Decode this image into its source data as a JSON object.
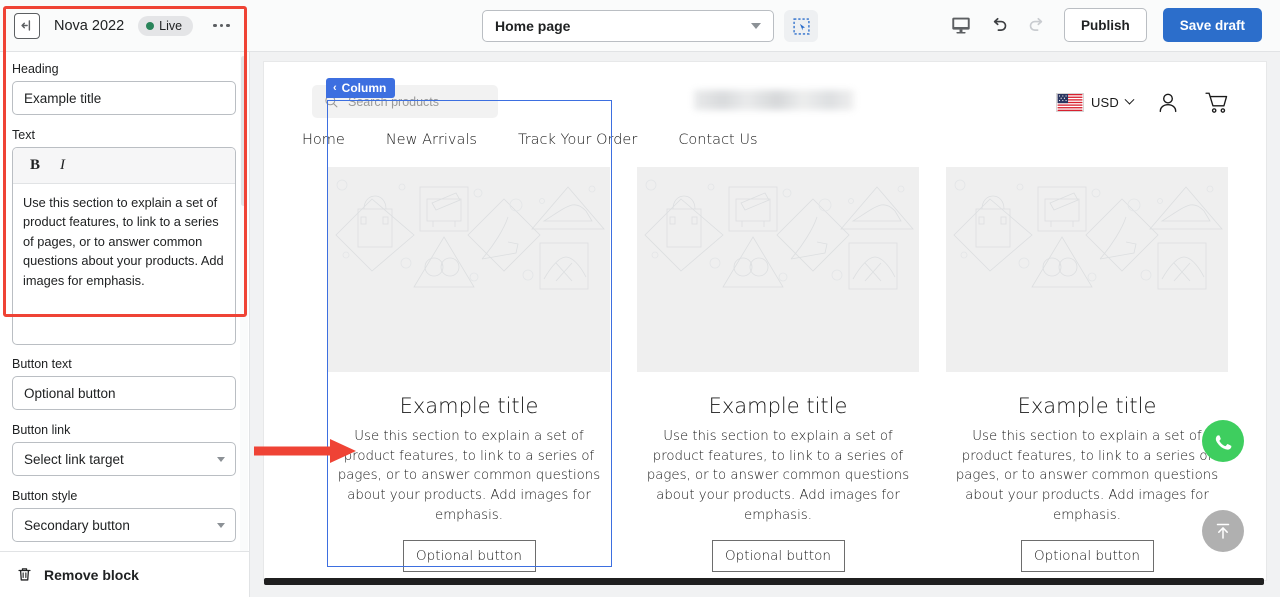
{
  "topbar": {
    "exit_icon": "exit-arrow-icon",
    "shop_name": "Nova 2022",
    "status_badge": "Live",
    "more_menu": "…",
    "page_selector": {
      "value": "Home page",
      "icon": "chevron-down-icon"
    },
    "select_tool_icon": "selection-cursor-icon",
    "preview_device_icon": "desktop-monitor-icon",
    "undo_icon": "undo-arrow-icon",
    "redo_icon": "redo-arrow-icon",
    "publish_label": "Publish",
    "save_draft_label": "Save draft",
    "accent_blue": "#2c6ecb",
    "live_green": "#29845a"
  },
  "panel": {
    "heading_label": "Heading",
    "heading_value": "Example title",
    "text_label": "Text",
    "bold_glyph": "B",
    "italic_glyph": "I",
    "text_value": "Use this section to explain a set of product features, to link to a series of pages, or to answer common questions about your products. Add images for emphasis.",
    "button_text_label": "Button text",
    "button_text_value": "Optional button",
    "button_link_label": "Button link",
    "button_link_value": "Select link target",
    "button_style_label": "Button style",
    "button_style_value": "Secondary button",
    "remove_block_label": "Remove block",
    "remove_block_icon": "trash-icon"
  },
  "annotations": {
    "highlight_color": "#ef4335",
    "rect_target": "heading-and-text-fields",
    "arrow_target": "column-body-text"
  },
  "storefront": {
    "search_placeholder": "Search products",
    "search_icon": "search-icon",
    "logo": "blurred-store-logo",
    "currency": {
      "flag": "us-flag-icon",
      "code": "USD",
      "chevron": "chevron-down-icon"
    },
    "account_icon": "user-account-icon",
    "cart_icon": "shopping-cart-icon",
    "nav": [
      "Home",
      "New Arrivals",
      "Track Your Order",
      "Contact Us"
    ],
    "selection_badge": {
      "back_glyph": "‹",
      "label": "Column",
      "color": "#3d6fe0"
    },
    "columns": [
      {
        "image": "product-placeholder-image",
        "title": "Example title",
        "body": "Use this section to explain a set of product features, to link to a series of pages, or to answer common questions about your products. Add images for emphasis.",
        "button": "Optional button"
      },
      {
        "image": "product-placeholder-image",
        "title": "Example title",
        "body": "Use this section to explain a set of product features, to link to a series of pages, or to answer common questions about your products. Add images for emphasis.",
        "button": "Optional button"
      },
      {
        "image": "product-placeholder-image",
        "title": "Example title",
        "body": "Use this section to explain a set of product features, to link to a series of pages, or to answer common questions about your products. Add images for emphasis.",
        "button": "Optional button"
      }
    ],
    "whatsapp_icon": "whatsapp-icon",
    "scroll_top_icon": "scroll-to-top-icon",
    "whatsapp_color": "#3ece5f"
  }
}
